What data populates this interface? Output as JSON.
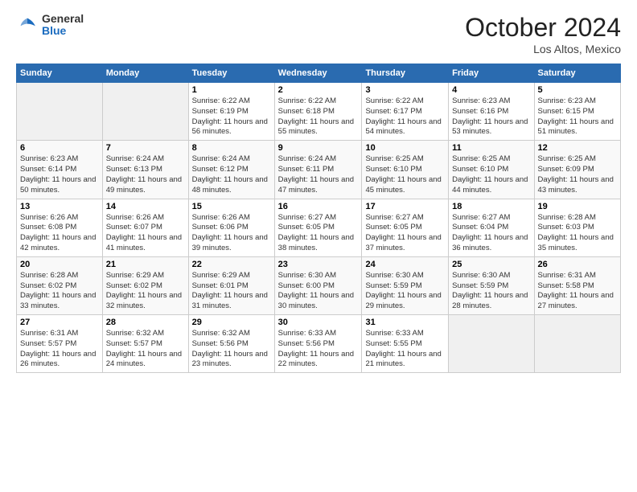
{
  "header": {
    "logo_general": "General",
    "logo_blue": "Blue",
    "month_title": "October 2024",
    "location": "Los Altos, Mexico"
  },
  "calendar": {
    "days_of_week": [
      "Sunday",
      "Monday",
      "Tuesday",
      "Wednesday",
      "Thursday",
      "Friday",
      "Saturday"
    ],
    "weeks": [
      [
        {
          "day": "",
          "detail": ""
        },
        {
          "day": "",
          "detail": ""
        },
        {
          "day": "1",
          "detail": "Sunrise: 6:22 AM\nSunset: 6:19 PM\nDaylight: 11 hours and 56 minutes."
        },
        {
          "day": "2",
          "detail": "Sunrise: 6:22 AM\nSunset: 6:18 PM\nDaylight: 11 hours and 55 minutes."
        },
        {
          "day": "3",
          "detail": "Sunrise: 6:22 AM\nSunset: 6:17 PM\nDaylight: 11 hours and 54 minutes."
        },
        {
          "day": "4",
          "detail": "Sunrise: 6:23 AM\nSunset: 6:16 PM\nDaylight: 11 hours and 53 minutes."
        },
        {
          "day": "5",
          "detail": "Sunrise: 6:23 AM\nSunset: 6:15 PM\nDaylight: 11 hours and 51 minutes."
        }
      ],
      [
        {
          "day": "6",
          "detail": "Sunrise: 6:23 AM\nSunset: 6:14 PM\nDaylight: 11 hours and 50 minutes."
        },
        {
          "day": "7",
          "detail": "Sunrise: 6:24 AM\nSunset: 6:13 PM\nDaylight: 11 hours and 49 minutes."
        },
        {
          "day": "8",
          "detail": "Sunrise: 6:24 AM\nSunset: 6:12 PM\nDaylight: 11 hours and 48 minutes."
        },
        {
          "day": "9",
          "detail": "Sunrise: 6:24 AM\nSunset: 6:11 PM\nDaylight: 11 hours and 47 minutes."
        },
        {
          "day": "10",
          "detail": "Sunrise: 6:25 AM\nSunset: 6:10 PM\nDaylight: 11 hours and 45 minutes."
        },
        {
          "day": "11",
          "detail": "Sunrise: 6:25 AM\nSunset: 6:10 PM\nDaylight: 11 hours and 44 minutes."
        },
        {
          "day": "12",
          "detail": "Sunrise: 6:25 AM\nSunset: 6:09 PM\nDaylight: 11 hours and 43 minutes."
        }
      ],
      [
        {
          "day": "13",
          "detail": "Sunrise: 6:26 AM\nSunset: 6:08 PM\nDaylight: 11 hours and 42 minutes."
        },
        {
          "day": "14",
          "detail": "Sunrise: 6:26 AM\nSunset: 6:07 PM\nDaylight: 11 hours and 41 minutes."
        },
        {
          "day": "15",
          "detail": "Sunrise: 6:26 AM\nSunset: 6:06 PM\nDaylight: 11 hours and 39 minutes."
        },
        {
          "day": "16",
          "detail": "Sunrise: 6:27 AM\nSunset: 6:05 PM\nDaylight: 11 hours and 38 minutes."
        },
        {
          "day": "17",
          "detail": "Sunrise: 6:27 AM\nSunset: 6:05 PM\nDaylight: 11 hours and 37 minutes."
        },
        {
          "day": "18",
          "detail": "Sunrise: 6:27 AM\nSunset: 6:04 PM\nDaylight: 11 hours and 36 minutes."
        },
        {
          "day": "19",
          "detail": "Sunrise: 6:28 AM\nSunset: 6:03 PM\nDaylight: 11 hours and 35 minutes."
        }
      ],
      [
        {
          "day": "20",
          "detail": "Sunrise: 6:28 AM\nSunset: 6:02 PM\nDaylight: 11 hours and 33 minutes."
        },
        {
          "day": "21",
          "detail": "Sunrise: 6:29 AM\nSunset: 6:02 PM\nDaylight: 11 hours and 32 minutes."
        },
        {
          "day": "22",
          "detail": "Sunrise: 6:29 AM\nSunset: 6:01 PM\nDaylight: 11 hours and 31 minutes."
        },
        {
          "day": "23",
          "detail": "Sunrise: 6:30 AM\nSunset: 6:00 PM\nDaylight: 11 hours and 30 minutes."
        },
        {
          "day": "24",
          "detail": "Sunrise: 6:30 AM\nSunset: 5:59 PM\nDaylight: 11 hours and 29 minutes."
        },
        {
          "day": "25",
          "detail": "Sunrise: 6:30 AM\nSunset: 5:59 PM\nDaylight: 11 hours and 28 minutes."
        },
        {
          "day": "26",
          "detail": "Sunrise: 6:31 AM\nSunset: 5:58 PM\nDaylight: 11 hours and 27 minutes."
        }
      ],
      [
        {
          "day": "27",
          "detail": "Sunrise: 6:31 AM\nSunset: 5:57 PM\nDaylight: 11 hours and 26 minutes."
        },
        {
          "day": "28",
          "detail": "Sunrise: 6:32 AM\nSunset: 5:57 PM\nDaylight: 11 hours and 24 minutes."
        },
        {
          "day": "29",
          "detail": "Sunrise: 6:32 AM\nSunset: 5:56 PM\nDaylight: 11 hours and 23 minutes."
        },
        {
          "day": "30",
          "detail": "Sunrise: 6:33 AM\nSunset: 5:56 PM\nDaylight: 11 hours and 22 minutes."
        },
        {
          "day": "31",
          "detail": "Sunrise: 6:33 AM\nSunset: 5:55 PM\nDaylight: 11 hours and 21 minutes."
        },
        {
          "day": "",
          "detail": ""
        },
        {
          "day": "",
          "detail": ""
        }
      ]
    ]
  }
}
